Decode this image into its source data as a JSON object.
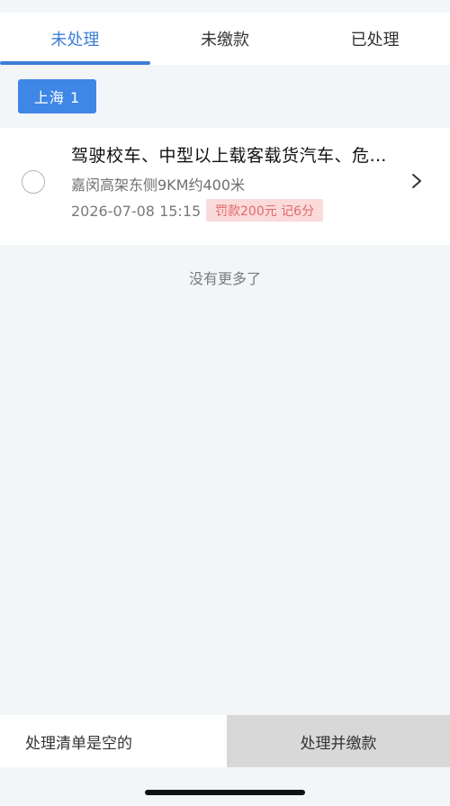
{
  "tabs": [
    {
      "label": "未处理",
      "active": true
    },
    {
      "label": "未缴款",
      "active": false
    },
    {
      "label": "已处理",
      "active": false
    }
  ],
  "region": {
    "label": "上海 1"
  },
  "violation": {
    "title": "驾驶校车、中型以上载客载货汽车、危…",
    "location": "嘉闵高架东侧9KM约400米",
    "time": "2026-07-08 15:15",
    "penalty": "罚款200元 记6分",
    "icon": "chevron-right-icon"
  },
  "list_footer": "没有更多了",
  "bottom": {
    "empty_label": "处理清单是空的",
    "pay_label": "处理并缴款"
  },
  "colors": {
    "accent": "#3c7ed8",
    "chip": "#3f86e6",
    "penalty_bg": "#fbdada",
    "penalty_text": "#e06a6a"
  }
}
